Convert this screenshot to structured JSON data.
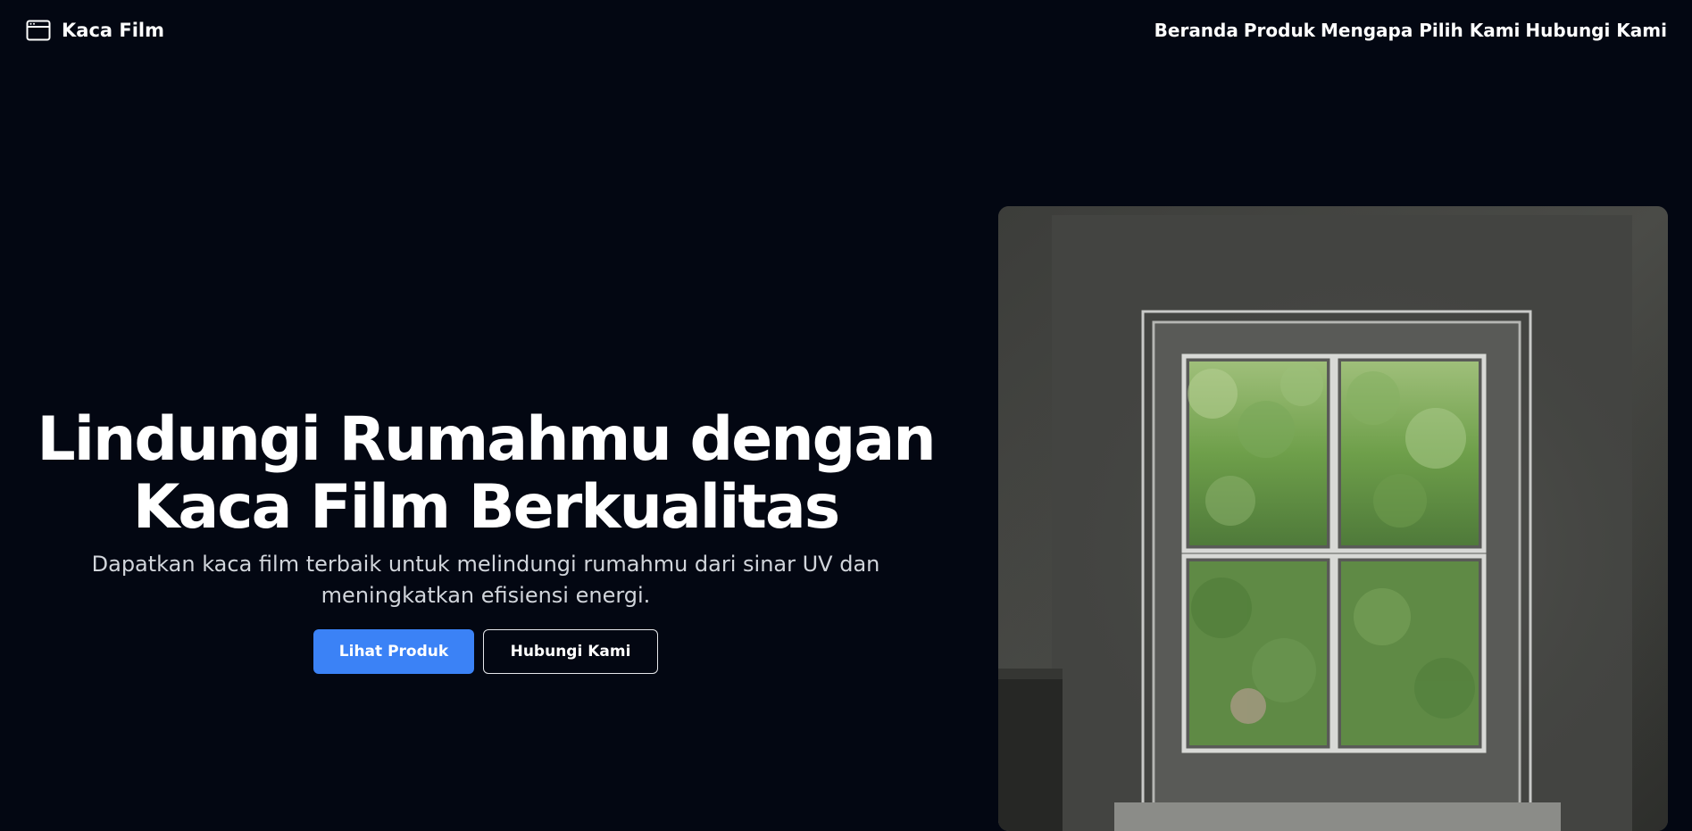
{
  "nav": {
    "brand": "Kaca Film",
    "brand_icon": "browser-window-icon",
    "links": [
      {
        "label": "Beranda"
      },
      {
        "label": "Produk"
      },
      {
        "label": "Mengapa Pilih Kami"
      },
      {
        "label": "Hubungi Kami"
      }
    ]
  },
  "hero": {
    "title_line1": "Lindungi Rumahmu dengan",
    "title_line2": "Kaca Film Berkualitas",
    "subtitle": "Dapatkan kaca film terbaik untuk melindungi rumahmu dari sinar UV dan meningkatkan efisiensi energi.",
    "primary_button": "Lihat Produk",
    "secondary_button": "Hubungi Kami"
  },
  "colors": {
    "background": "#030712",
    "accent": "#3b82f6",
    "text": "#ffffff",
    "subtitle": "#d1d5db"
  }
}
